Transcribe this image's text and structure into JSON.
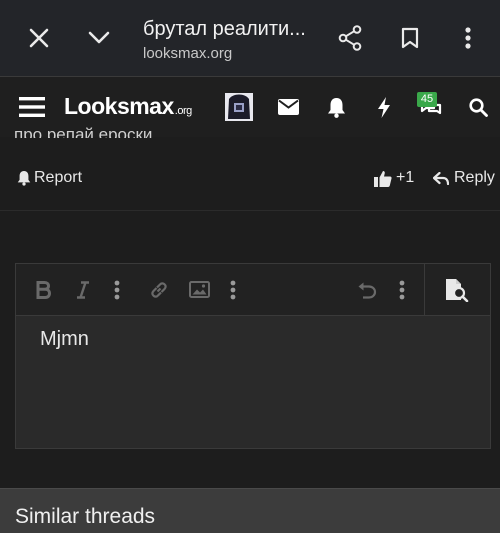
{
  "browser": {
    "page_title": "брутал реалити...",
    "url": "looksmax.org",
    "close_icon": "close-icon",
    "collapse_icon": "chevron-down-icon",
    "share_icon": "share-icon",
    "bookmark_icon": "bookmark-icon",
    "menu_icon": "more-vertical-icon"
  },
  "header": {
    "logo_main": "Looksmax",
    "logo_suffix": ".org",
    "alerts_badge": "45",
    "icons": [
      "menu-icon",
      "avatar",
      "mail-icon",
      "bell-icon",
      "bolt-icon",
      "chat-icon",
      "search-icon"
    ]
  },
  "post": {
    "cut_text": "про репай ероски",
    "report_label": "Report",
    "reaction_label": "+1",
    "reply_label": "Reply"
  },
  "editor": {
    "content": "Mjmn",
    "toolbar_icons": [
      "bold-icon",
      "italic-icon",
      "more-vertical-icon",
      "link-icon",
      "image-icon",
      "more-vertical-icon",
      "undo-icon",
      "more-vertical-icon",
      "preview-icon"
    ]
  },
  "similar": {
    "heading": "Similar threads"
  },
  "colors": {
    "badge": "#3aa84a",
    "background": "#1d1d1d"
  }
}
